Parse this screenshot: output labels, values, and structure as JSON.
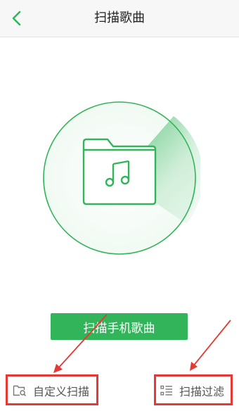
{
  "header": {
    "title": "扫描歌曲",
    "back_icon": "chevron-left-icon"
  },
  "scanner": {
    "icon": "music-folder-icon",
    "accent_color": "#32b55a"
  },
  "main": {
    "scan_button_label": "扫描手机歌曲"
  },
  "bottom": {
    "custom_scan_label": "自定义扫描",
    "custom_scan_icon": "folder-search-icon",
    "filter_label": "扫描过滤",
    "filter_icon": "list-filter-icon"
  },
  "annotations": {
    "highlight_color": "#e53935"
  }
}
